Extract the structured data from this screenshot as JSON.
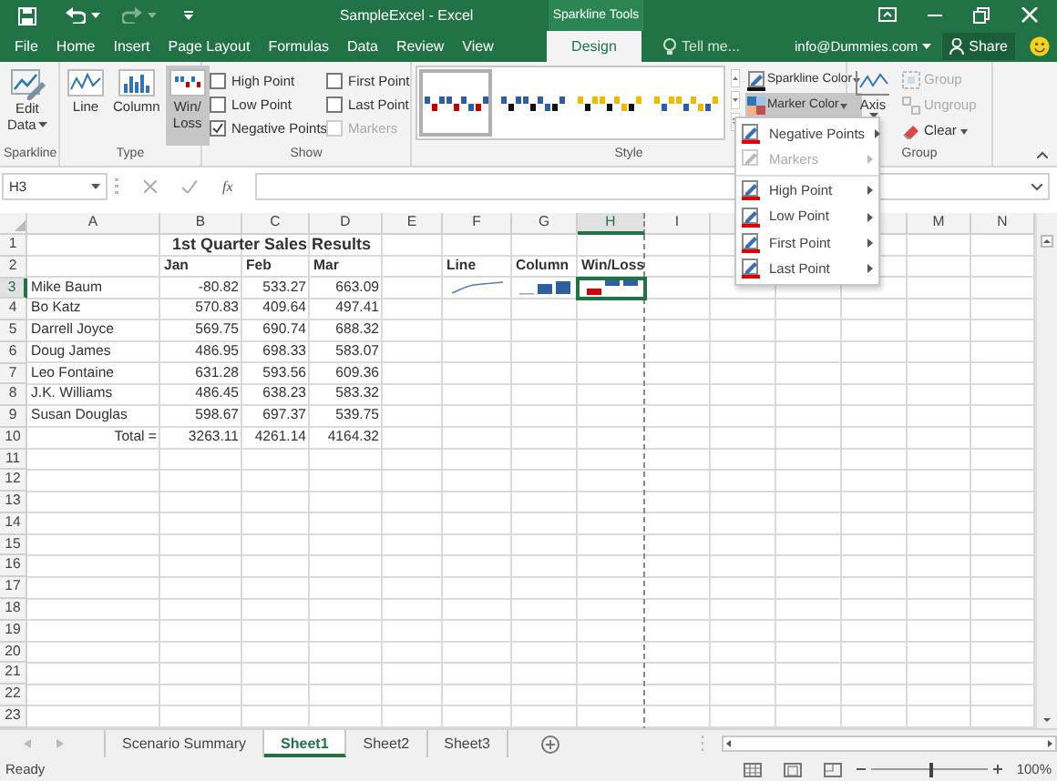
{
  "title_bar": {
    "title": "SampleExcel - Excel",
    "context_label": "Sparkline Tools"
  },
  "tabs": [
    {
      "label": "File",
      "selected": false
    },
    {
      "label": "Home",
      "selected": false
    },
    {
      "label": "Insert",
      "selected": false
    },
    {
      "label": "Page Layout",
      "selected": false
    },
    {
      "label": "Formulas",
      "selected": false
    },
    {
      "label": "Data",
      "selected": false
    },
    {
      "label": "Review",
      "selected": false
    },
    {
      "label": "View",
      "selected": false
    },
    {
      "label": "Design",
      "selected": true
    }
  ],
  "tell_me": {
    "placeholder": "Tell me..."
  },
  "account": "info@Dummies.com",
  "share": "Share",
  "sparkline_group": {
    "label": "Sparkline",
    "edit_data": [
      "Edit",
      "Data"
    ]
  },
  "type_group": {
    "label": "Type",
    "buttons": [
      {
        "kind": "line",
        "lines": [
          "Line"
        ],
        "selected": false
      },
      {
        "kind": "column",
        "lines": [
          "Column"
        ],
        "selected": false
      },
      {
        "kind": "winloss",
        "lines": [
          "Win/",
          "Loss"
        ],
        "selected": true
      }
    ]
  },
  "show_group": {
    "label": "Show",
    "options": [
      {
        "label": "High Point",
        "checked": false,
        "disabled": false
      },
      {
        "label": "Low Point",
        "checked": false,
        "disabled": false
      },
      {
        "label": "Negative Points",
        "checked": true,
        "disabled": false
      },
      {
        "label": "First Point",
        "checked": false,
        "disabled": false
      },
      {
        "label": "Last Point",
        "checked": false,
        "disabled": false
      },
      {
        "label": "Markers",
        "checked": false,
        "disabled": true
      }
    ]
  },
  "style_group": {
    "label": "Style",
    "styles": [
      {
        "selected": true,
        "bars": [
          {
            "color": "#2e5fa3"
          },
          {
            "color": "#c00000"
          }
        ]
      },
      {
        "selected": false,
        "bars": [
          {
            "color": "#2e5fa3"
          },
          {
            "color": "#111111"
          }
        ]
      },
      {
        "selected": false,
        "bars": [
          {
            "color": "#f2b800"
          },
          {
            "color": "#111111"
          }
        ]
      },
      {
        "selected": false,
        "bars": [
          {
            "color": "#f2b800"
          },
          {
            "color": "#2e5fa3"
          }
        ]
      }
    ],
    "color_buttons": [
      {
        "kind": "sparkline",
        "label": "Sparkline Color",
        "open": false
      },
      {
        "kind": "marker",
        "label": "Marker Color",
        "open": true
      }
    ]
  },
  "group_group": {
    "label": "Group",
    "axis": "Axis",
    "items": [
      {
        "kind": "group",
        "label": "Group",
        "disabled": true
      },
      {
        "kind": "ungroup",
        "label": "Ungroup",
        "disabled": true
      },
      {
        "kind": "clear",
        "label": "Clear",
        "disabled": false
      }
    ]
  },
  "marker_menu": {
    "sections": [
      {
        "items": [
          {
            "label": "Negative Points",
            "disabled": false
          },
          {
            "label": "Markers",
            "disabled": true
          }
        ]
      },
      {
        "items": [
          {
            "label": "High Point",
            "disabled": false
          },
          {
            "label": "Low Point",
            "disabled": false
          },
          {
            "label": "First Point",
            "disabled": false
          },
          {
            "label": "Last Point",
            "disabled": false
          }
        ]
      }
    ]
  },
  "formula_bar": {
    "name_box": "H3",
    "function_label": "fx"
  },
  "columns": [
    {
      "label": "A",
      "selected": false,
      "page_break": false
    },
    {
      "label": "B",
      "selected": false,
      "page_break": false
    },
    {
      "label": "C",
      "selected": false,
      "page_break": false
    },
    {
      "label": "D",
      "selected": false,
      "page_break": false
    },
    {
      "label": "E",
      "selected": false,
      "page_break": false
    },
    {
      "label": "F",
      "selected": false,
      "page_break": false
    },
    {
      "label": "G",
      "selected": false,
      "page_break": false
    },
    {
      "label": "H",
      "selected": true,
      "page_break": true
    },
    {
      "label": "I",
      "selected": false,
      "page_break": false
    },
    null,
    null,
    null,
    {
      "label": "M",
      "selected": false,
      "page_break": false
    },
    {
      "label": "N",
      "selected": false,
      "page_break": false
    }
  ],
  "rows": [
    {
      "label": "1",
      "selected": false,
      "cells": [
        null,
        {
          "kind": "title",
          "text": "1st Quarter Sales Results"
        }
      ]
    },
    {
      "label": "2",
      "selected": false,
      "cells": [
        null,
        {
          "kind": "header",
          "text": "Jan"
        },
        {
          "kind": "header",
          "text": "Feb"
        },
        {
          "kind": "header",
          "text": "Mar"
        },
        null,
        {
          "kind": "header",
          "text": "Line"
        },
        {
          "kind": "header",
          "text": "Column"
        },
        {
          "kind": "header",
          "text": "Win/Loss"
        }
      ]
    },
    {
      "label": "3",
      "selected": true,
      "cells": [
        {
          "kind": "text",
          "text": "Mike Baum"
        },
        {
          "kind": "number",
          "text": "-80.82"
        },
        {
          "kind": "number",
          "text": "533.27"
        },
        {
          "kind": "number",
          "text": "663.09"
        },
        null,
        {
          "kind": "line-sparkline"
        },
        {
          "kind": "column-sparkline"
        },
        {
          "kind": "winloss-sparkline"
        }
      ]
    },
    {
      "label": "4",
      "selected": false,
      "cells": [
        {
          "kind": "text",
          "text": "Bo Katz"
        },
        {
          "kind": "number",
          "text": "570.83"
        },
        {
          "kind": "number",
          "text": "409.64"
        },
        {
          "kind": "number",
          "text": "497.41"
        }
      ]
    },
    {
      "label": "5",
      "selected": false,
      "cells": [
        {
          "kind": "text",
          "text": "Darrell Joyce"
        },
        {
          "kind": "number",
          "text": "569.75"
        },
        {
          "kind": "number",
          "text": "690.74"
        },
        {
          "kind": "number",
          "text": "688.32"
        }
      ]
    },
    {
      "label": "6",
      "selected": false,
      "cells": [
        {
          "kind": "text",
          "text": "Doug James"
        },
        {
          "kind": "number",
          "text": "486.95"
        },
        {
          "kind": "number",
          "text": "698.33"
        },
        {
          "kind": "number",
          "text": "583.07"
        }
      ]
    },
    {
      "label": "7",
      "selected": false,
      "cells": [
        {
          "kind": "text",
          "text": "Leo Fontaine"
        },
        {
          "kind": "number",
          "text": "631.28"
        },
        {
          "kind": "number",
          "text": "593.56"
        },
        {
          "kind": "number",
          "text": "609.36"
        }
      ]
    },
    {
      "label": "8",
      "selected": false,
      "cells": [
        {
          "kind": "text",
          "text": "J.K. Williams"
        },
        {
          "kind": "number",
          "text": "486.45"
        },
        {
          "kind": "number",
          "text": "638.23"
        },
        {
          "kind": "number",
          "text": "583.32"
        }
      ]
    },
    {
      "label": "9",
      "selected": false,
      "cells": [
        {
          "kind": "text",
          "text": "Susan Douglas"
        },
        {
          "kind": "number",
          "text": "598.67"
        },
        {
          "kind": "number",
          "text": "697.37"
        },
        {
          "kind": "number",
          "text": "539.75"
        }
      ]
    },
    {
      "label": "10",
      "selected": false,
      "cells": [
        {
          "kind": "number",
          "text": "Total ="
        },
        {
          "kind": "number",
          "text": "3263.11"
        },
        {
          "kind": "number",
          "text": "4261.14"
        },
        {
          "kind": "number",
          "text": "4164.32"
        }
      ]
    },
    {
      "label": "11",
      "selected": false
    },
    {
      "label": "12",
      "selected": false
    },
    {
      "label": "13",
      "selected": false
    },
    {
      "label": "14",
      "selected": false
    },
    {
      "label": "15",
      "selected": false
    },
    {
      "label": "16",
      "selected": false
    },
    {
      "label": "17",
      "selected": false
    },
    {
      "label": "18",
      "selected": false
    },
    {
      "label": "19",
      "selected": false
    },
    {
      "label": "20",
      "selected": false
    },
    {
      "label": "21",
      "selected": false
    },
    {
      "label": "22",
      "selected": false
    },
    {
      "label": "23",
      "selected": false
    }
  ],
  "sheet_tabs": [
    {
      "label": "Scenario Summary",
      "selected": false
    },
    {
      "label": "Sheet1",
      "selected": true
    },
    {
      "label": "Sheet2",
      "selected": false
    },
    {
      "label": "Sheet3",
      "selected": false
    }
  ],
  "status_bar": {
    "status": "Ready",
    "zoom": {
      "label": "100%",
      "level": 0.52
    }
  }
}
